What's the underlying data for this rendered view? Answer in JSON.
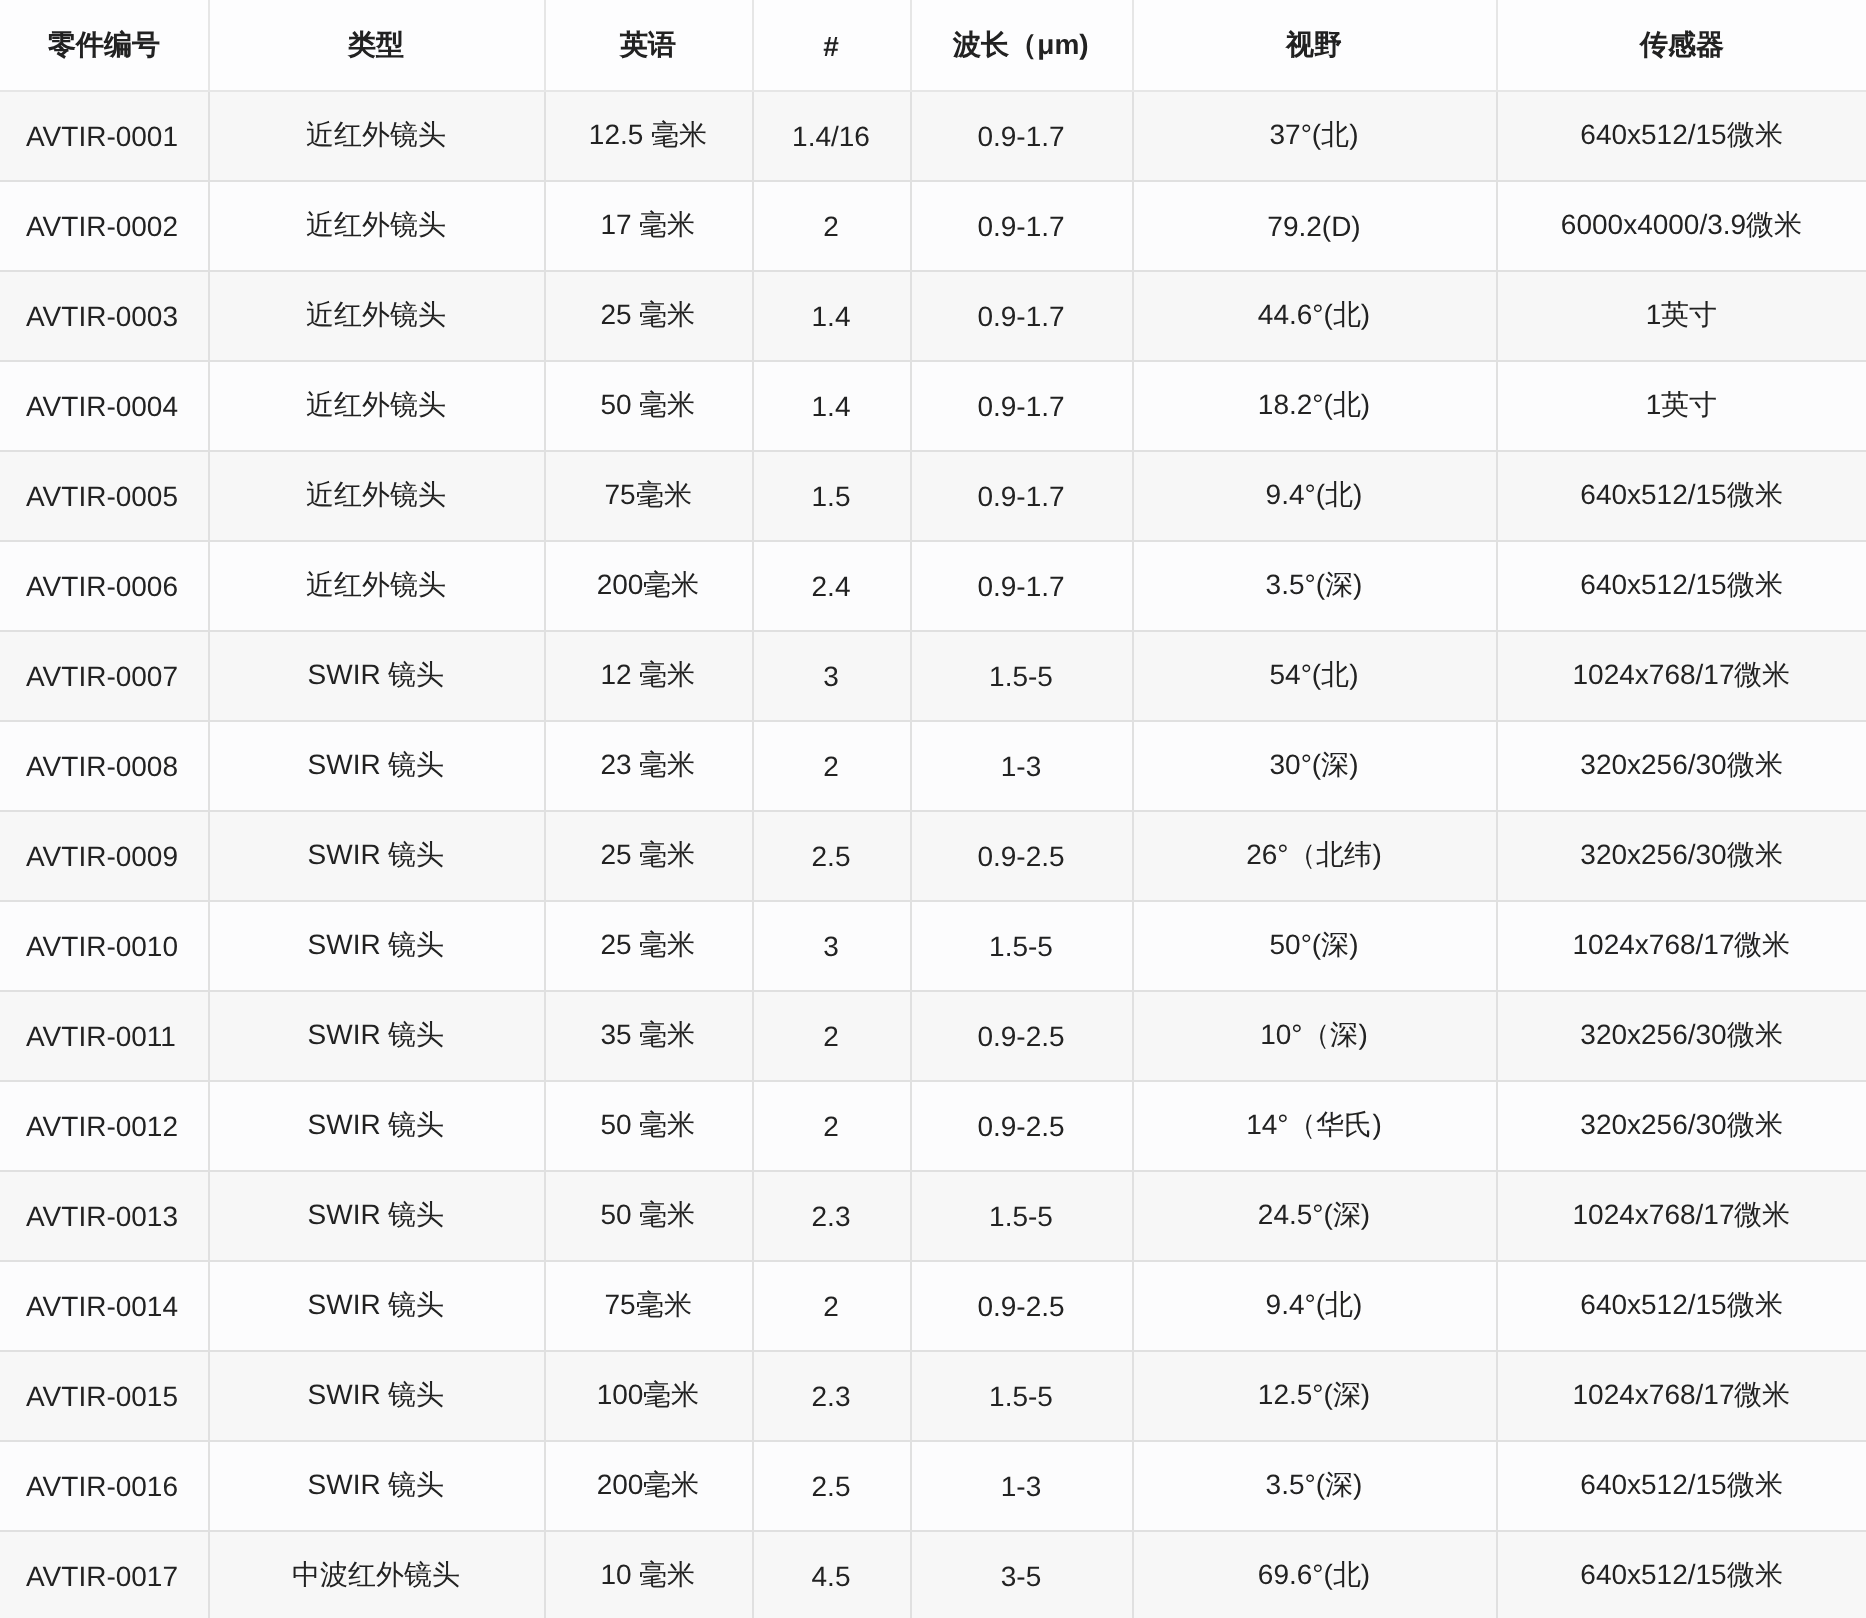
{
  "table": {
    "columns": [
      "零件编号",
      "类型",
      "英语",
      "#",
      "波长（μm)",
      "视野",
      "传感器"
    ],
    "rows": [
      [
        "AVTIR-0001",
        "近红外镜头",
        "12.5 毫米",
        "1.4/16",
        "0.9-1.7",
        "37°(北)",
        "640x512/15微米"
      ],
      [
        "AVTIR-0002",
        "近红外镜头",
        "17 毫米",
        "2",
        "0.9-1.7",
        "79.2(D)",
        "6000x4000/3.9微米"
      ],
      [
        "AVTIR-0003",
        "近红外镜头",
        "25 毫米",
        "1.4",
        "0.9-1.7",
        "44.6°(北)",
        "1英寸"
      ],
      [
        "AVTIR-0004",
        "近红外镜头",
        "50 毫米",
        "1.4",
        "0.9-1.7",
        "18.2°(北)",
        "1英寸"
      ],
      [
        "AVTIR-0005",
        "近红外镜头",
        "75毫米",
        "1.5",
        "0.9-1.7",
        "9.4°(北)",
        "640x512/15微米"
      ],
      [
        "AVTIR-0006",
        "近红外镜头",
        "200毫米",
        "2.4",
        "0.9-1.7",
        "3.5°(深)",
        "640x512/15微米"
      ],
      [
        "AVTIR-0007",
        "SWIR 镜头",
        "12 毫米",
        "3",
        "1.5-5",
        "54°(北)",
        "1024x768/17微米"
      ],
      [
        "AVTIR-0008",
        "SWIR 镜头",
        "23 毫米",
        "2",
        "1-3",
        "30°(深)",
        "320x256/30微米"
      ],
      [
        "AVTIR-0009",
        "SWIR 镜头",
        "25 毫米",
        "2.5",
        "0.9-2.5",
        "26°（北纬)",
        "320x256/30微米"
      ],
      [
        "AVTIR-0010",
        "SWIR 镜头",
        "25 毫米",
        "3",
        "1.5-5",
        "50°(深)",
        "1024x768/17微米"
      ],
      [
        "AVTIR-0011",
        "SWIR 镜头",
        "35 毫米",
        "2",
        "0.9-2.5",
        "10°（深)",
        "320x256/30微米"
      ],
      [
        "AVTIR-0012",
        "SWIR 镜头",
        "50 毫米",
        "2",
        "0.9-2.5",
        "14°（华氏)",
        "320x256/30微米"
      ],
      [
        "AVTIR-0013",
        "SWIR 镜头",
        "50 毫米",
        "2.3",
        "1.5-5",
        "24.5°(深)",
        "1024x768/17微米"
      ],
      [
        "AVTIR-0014",
        "SWIR 镜头",
        "75毫米",
        "2",
        "0.9-2.5",
        "9.4°(北)",
        "640x512/15微米"
      ],
      [
        "AVTIR-0015",
        "SWIR 镜头",
        "100毫米",
        "2.3",
        "1.5-5",
        "12.5°(深)",
        "1024x768/17微米"
      ],
      [
        "AVTIR-0016",
        "SWIR 镜头",
        "200毫米",
        "2.5",
        "1-3",
        "3.5°(深)",
        "640x512/15微米"
      ],
      [
        "AVTIR-0017",
        "中波红外镜头",
        "10 毫米",
        "4.5",
        "3-5",
        "69.6°(北)",
        "640x512/15微米"
      ]
    ]
  }
}
